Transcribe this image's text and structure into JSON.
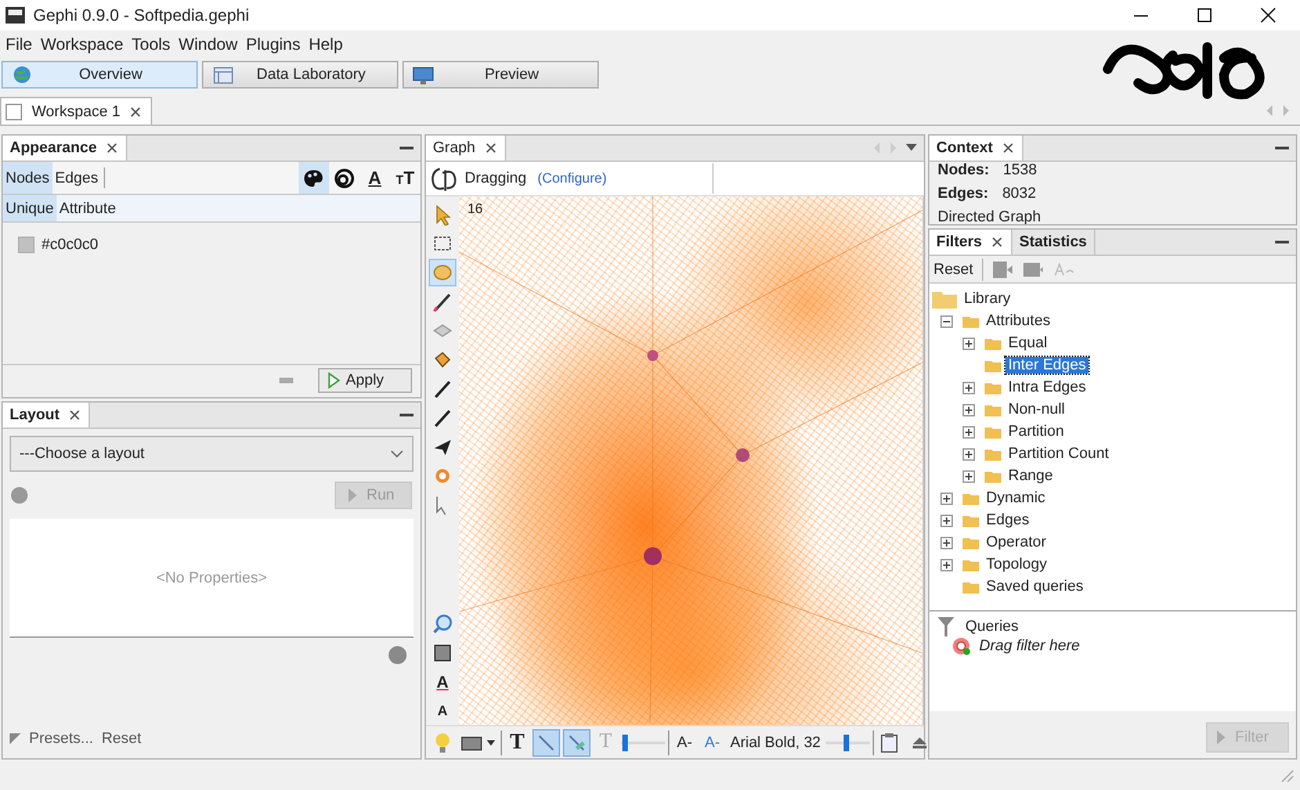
{
  "window": {
    "title": "Gephi 0.9.0 - Softpedia.gephi"
  },
  "menu": [
    "File",
    "Workspace",
    "Tools",
    "Window",
    "Plugins",
    "Help"
  ],
  "perspectives": [
    {
      "label": "Overview",
      "kind": "globe",
      "selected": true
    },
    {
      "label": "Data Laboratory",
      "kind": "table",
      "selected": false
    },
    {
      "label": "Preview",
      "kind": "monitor",
      "selected": false
    }
  ],
  "workspace_tabs": [
    {
      "label": "Workspace 1",
      "selected": true
    }
  ],
  "appearance": {
    "tab": "Appearance",
    "element_tabs": [
      {
        "label": "Nodes",
        "selected": true
      },
      {
        "label": "Edges",
        "selected": false
      }
    ],
    "property_tools": [
      {
        "kind": "color",
        "selected": true
      },
      {
        "kind": "size",
        "selected": false
      },
      {
        "kind": "label-color",
        "symbol": "A",
        "selected": false
      },
      {
        "kind": "label-size",
        "symbol": "TT",
        "selected": false
      }
    ],
    "modes": [
      {
        "label": "Unique",
        "selected": true
      },
      {
        "label": "Attribute",
        "selected": false
      }
    ],
    "color_value": "#c0c0c0",
    "apply_button": "Apply"
  },
  "layout": {
    "tab": "Layout",
    "select": "---Choose a layout",
    "run_button": {
      "label": "Run",
      "disabled": true
    },
    "properties_placeholder": "<No Properties>",
    "presets": "Presets...",
    "reset": "Reset"
  },
  "graph": {
    "tab": "Graph",
    "mode": "Dragging",
    "configure_link": "(Configure)",
    "counter": "16",
    "tools": [
      {
        "kind": "pointer",
        "selected": false
      },
      {
        "kind": "rectangle-select",
        "selected": false
      },
      {
        "kind": "drag",
        "selected": true
      },
      {
        "kind": "brush",
        "selected": false
      },
      {
        "kind": "diamond",
        "selected": false
      },
      {
        "kind": "bucket",
        "selected": false
      },
      {
        "kind": "pen",
        "selected": false
      },
      {
        "kind": "pen",
        "selected": false
      },
      {
        "kind": "plane",
        "selected": false
      },
      {
        "kind": "burst",
        "selected": false
      },
      {
        "kind": "cursor",
        "selected": false
      },
      {
        "kind": "gap"
      },
      {
        "kind": "zoom-fit",
        "selected": false
      },
      {
        "kind": "square",
        "selected": false
      },
      {
        "kind": "label-color",
        "symbol": "A",
        "selected": false
      },
      {
        "kind": "label-size",
        "symbol": "A",
        "selected": false
      }
    ],
    "bottom_tools": [
      {
        "kind": "bulb"
      },
      {
        "kind": "screenshot"
      },
      {
        "kind": "text-toggle",
        "symbol": "T",
        "selected": false,
        "disabled": false
      },
      {
        "kind": "edges",
        "selected": true,
        "disabled": false
      },
      {
        "kind": "edge-color",
        "selected": true,
        "disabled": false
      },
      {
        "kind": "edge-label",
        "symbol": "T",
        "selected": false,
        "disabled": true
      },
      {
        "kind": "slider",
        "level": 0.1
      },
      {
        "kind": "font-size",
        "symbol": "A-"
      },
      {
        "kind": "font-color",
        "symbol": "A-"
      },
      {
        "kind": "font-name",
        "text": "Arial Bold, 32"
      },
      {
        "kind": "slider",
        "level": 0.45
      },
      {
        "kind": "table"
      },
      {
        "kind": "collapse"
      }
    ]
  },
  "context": {
    "tab": "Context",
    "nodes_label": "Nodes:",
    "nodes": "1538",
    "edges_label": "Edges:",
    "edges": "8032",
    "graph_type": "Directed Graph"
  },
  "filters": {
    "tabs": [
      {
        "label": "Filters",
        "selected": true
      },
      {
        "label": "Statistics",
        "selected": false
      }
    ],
    "reset": "Reset",
    "library": {
      "label": "Library",
      "children": [
        {
          "label": "Attributes",
          "kind": "group",
          "expanded": true,
          "selected": false,
          "children": [
            {
              "label": "Equal",
              "kind": "group",
              "expanded": false,
              "selected": false
            },
            {
              "label": "Inter Edges",
              "kind": "leaf",
              "selected": true
            },
            {
              "label": "Intra Edges",
              "kind": "group",
              "expanded": false,
              "selected": false
            },
            {
              "label": "Non-null",
              "kind": "group",
              "expanded": false,
              "selected": false
            },
            {
              "label": "Partition",
              "kind": "group",
              "expanded": false,
              "selected": false
            },
            {
              "label": "Partition Count",
              "kind": "group",
              "expanded": false,
              "selected": false
            },
            {
              "label": "Range",
              "kind": "group",
              "expanded": false,
              "selected": false
            }
          ]
        },
        {
          "label": "Dynamic",
          "kind": "group",
          "expanded": false,
          "selected": false
        },
        {
          "label": "Edges",
          "kind": "group",
          "expanded": false,
          "selected": false
        },
        {
          "label": "Operator",
          "kind": "group",
          "expanded": false,
          "selected": false
        },
        {
          "label": "Topology",
          "kind": "group",
          "expanded": false,
          "selected": false
        },
        {
          "label": "Saved queries",
          "kind": "leaf",
          "selected": false
        }
      ]
    },
    "queries": {
      "label": "Queries",
      "hint": "Drag filter here"
    },
    "filter_button": {
      "label": "Filter",
      "disabled": true
    }
  }
}
